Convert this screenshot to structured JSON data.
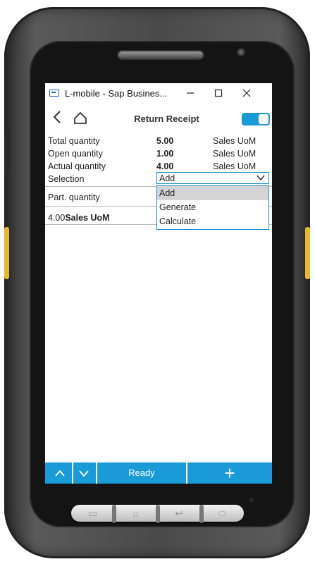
{
  "window": {
    "title": "L-mobile - Sap Busines...",
    "minimize_icon": "minimize-icon",
    "maximize_icon": "maximize-icon",
    "close_icon": "close-icon"
  },
  "header": {
    "title": "Return Receipt",
    "back_icon": "chevron-left-icon",
    "home_icon": "home-icon",
    "toggle_on": true
  },
  "fields": [
    {
      "label": "Total quantity",
      "value": "5.00",
      "unit": "Sales UoM"
    },
    {
      "label": "Open quantity",
      "value": "1.00",
      "unit": "Sales UoM"
    },
    {
      "label": "Actual quantity",
      "value": "4.00",
      "unit": "Sales UoM"
    }
  ],
  "selection": {
    "label": "Selection",
    "value": "Add",
    "options": [
      "Add",
      "Generate",
      "Calculate"
    ],
    "selected_index": 0
  },
  "part_quantity": {
    "label": "Part. quantity",
    "value": "4.00",
    "unit": "Sales UoM"
  },
  "toolbar": {
    "status": "Ready",
    "add_label": "+",
    "up_icon": "chevron-up-icon",
    "down_icon": "chevron-down-icon"
  },
  "colors": {
    "accent": "#1a9bd7",
    "select_border": "#1a8fd6",
    "highlight": "#d4d4d4",
    "device_yellow": "#e8b82e"
  }
}
